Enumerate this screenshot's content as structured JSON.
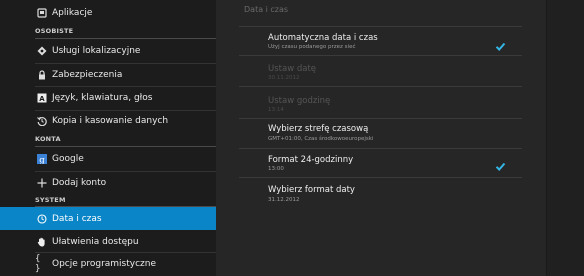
{
  "sidebar": {
    "items": [
      {
        "label": "Aplikacje",
        "icon": "apps-icon"
      },
      {
        "label": "Usługi lokalizacyjne",
        "icon": "location-icon"
      },
      {
        "label": "Zabezpieczenia",
        "icon": "lock-icon"
      },
      {
        "label": "Język, klawiatura, głos",
        "icon": "language-icon"
      },
      {
        "label": "Kopia i kasowanie danych",
        "icon": "backup-icon"
      },
      {
        "label": "Google",
        "icon": "google-icon"
      },
      {
        "label": "Dodaj konto",
        "icon": "plus-icon"
      },
      {
        "label": "Data i czas",
        "icon": "clock-icon",
        "selected": true
      },
      {
        "label": "Ułatwienia dostępu",
        "icon": "hand-icon"
      },
      {
        "label": "Opcje programistyczne",
        "icon": "braces-icon"
      }
    ],
    "headers": {
      "personal": "OSOBISTE",
      "accounts": "KONTA",
      "system": "SYSTEM"
    }
  },
  "main": {
    "section_title": "Data i czas",
    "rows": [
      {
        "title": "Automatyczna data i czas",
        "subtitle": "Użyj czasu podanego przez sieć",
        "checked": true,
        "enabled": true
      },
      {
        "title": "Ustaw datę",
        "subtitle": "30.11.2012",
        "enabled": false
      },
      {
        "title": "Ustaw godzinę",
        "subtitle": "13:14",
        "enabled": false
      },
      {
        "title": "Wybierz strefę czasową",
        "subtitle": "GMT+01:00, Czas środkowoeuropejski",
        "enabled": true
      },
      {
        "title": "Format 24-godzinny",
        "subtitle": "13:00",
        "checked": true,
        "enabled": true
      },
      {
        "title": "Wybierz format daty",
        "subtitle": "31.12.2012",
        "enabled": true
      }
    ]
  },
  "colors": {
    "accent": "#0a85c7",
    "check": "#33b5e5"
  }
}
